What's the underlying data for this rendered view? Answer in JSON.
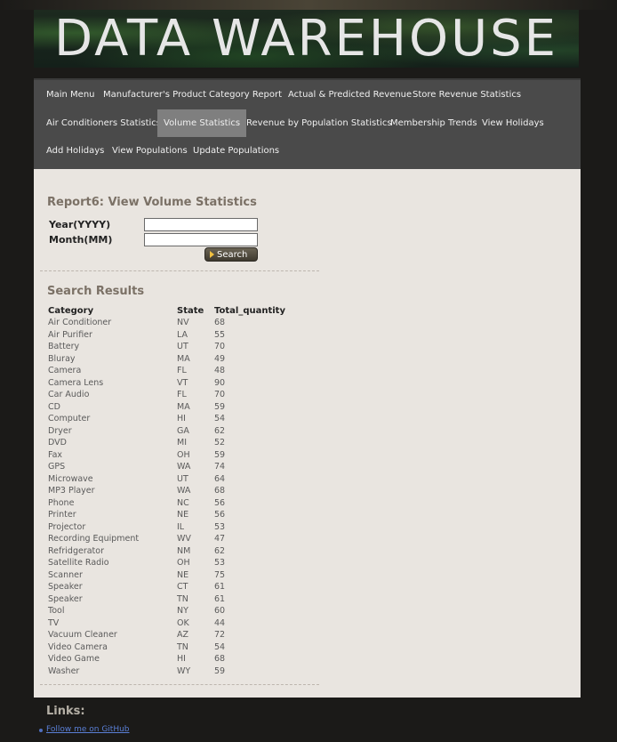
{
  "banner": {
    "title": "DATA WAREHOUSE"
  },
  "nav": {
    "row1": [
      "Main Menu",
      "Manufacturer's Product",
      "Category Report",
      "Actual & Predicted Revenue",
      "Store Revenue Statistics"
    ],
    "row2": [
      "Air Conditioners Statistics",
      "Volume Statistics",
      "Revenue by Population Statistics",
      "Membership Trends",
      "View Holidays"
    ],
    "row3": [
      "Add Holidays",
      "View Populations",
      "Update Populations"
    ],
    "active": "Volume Statistics"
  },
  "report": {
    "title": "Report6: View Volume Statistics",
    "year_label": "Year(YYYY)",
    "year_value": "",
    "month_label": "Month(MM)",
    "month_value": "",
    "search_label": "Search"
  },
  "results": {
    "title": "Search Results",
    "headers": [
      "Category",
      "State",
      "Total_quantity"
    ],
    "rows": [
      [
        "Air Conditioner",
        "NV",
        "68"
      ],
      [
        "Air Purifier",
        "LA",
        "55"
      ],
      [
        "Battery",
        "UT",
        "70"
      ],
      [
        "Bluray",
        "MA",
        "49"
      ],
      [
        "Camera",
        "FL",
        "48"
      ],
      [
        "Camera Lens",
        "VT",
        "90"
      ],
      [
        "Car Audio",
        "FL",
        "70"
      ],
      [
        "CD",
        "MA",
        "59"
      ],
      [
        "Computer",
        "HI",
        "54"
      ],
      [
        "Dryer",
        "GA",
        "62"
      ],
      [
        "DVD",
        "MI",
        "52"
      ],
      [
        "Fax",
        "OH",
        "59"
      ],
      [
        "GPS",
        "WA",
        "74"
      ],
      [
        "Microwave",
        "UT",
        "64"
      ],
      [
        "MP3 Player",
        "WA",
        "68"
      ],
      [
        "Phone",
        "NC",
        "56"
      ],
      [
        "Printer",
        "NE",
        "56"
      ],
      [
        "Projector",
        "IL",
        "53"
      ],
      [
        "Recording Equipment",
        "WV",
        "47"
      ],
      [
        "Refridgerator",
        "NM",
        "62"
      ],
      [
        "Satellite Radio",
        "OH",
        "53"
      ],
      [
        "Scanner",
        "NE",
        "75"
      ],
      [
        "Speaker",
        "CT",
        "61"
      ],
      [
        "Speaker",
        "TN",
        "61"
      ],
      [
        "Tool",
        "NY",
        "60"
      ],
      [
        "TV",
        "OK",
        "44"
      ],
      [
        "Vacuum Cleaner",
        "AZ",
        "72"
      ],
      [
        "Video Camera",
        "TN",
        "54"
      ],
      [
        "Video Game",
        "HI",
        "68"
      ],
      [
        "Washer",
        "WY",
        "59"
      ]
    ]
  },
  "footer": {
    "links_title": "Links:",
    "github_link": "Follow me on GitHub"
  }
}
